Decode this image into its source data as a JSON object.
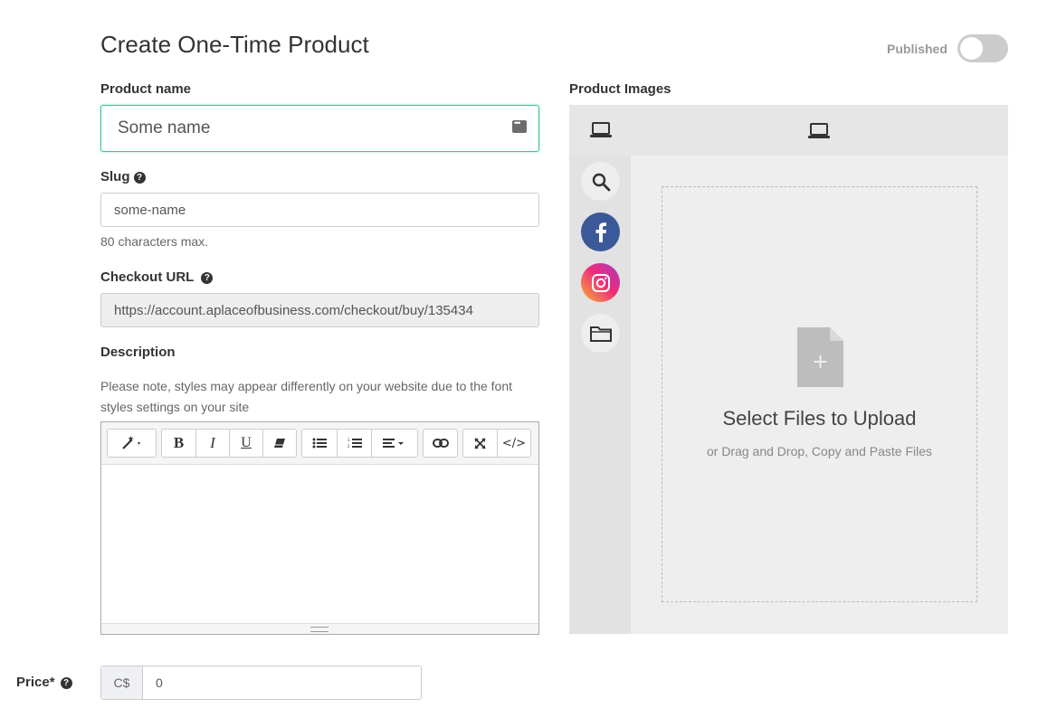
{
  "page": {
    "title": "Create One-Time Product"
  },
  "published": {
    "label": "Published",
    "checked": false
  },
  "product_name": {
    "label": "Product name",
    "value": "Some name"
  },
  "slug": {
    "label": "Slug",
    "value": "some-name",
    "hint": "80 characters max."
  },
  "checkout_url": {
    "label": "Checkout URL",
    "value": "https://account.aplaceofbusiness.com/checkout/buy/135434"
  },
  "description": {
    "label": "Description",
    "note": "Please note, styles may appear differently on your website due to the font styles settings on your site",
    "toolbar": {
      "bold": "B",
      "italic": "I",
      "underline": "U",
      "code": "</>"
    }
  },
  "images": {
    "label": "Product Images",
    "upload_title": "Select Files to Upload",
    "upload_subtitle": "or Drag and Drop, Copy and Paste Files"
  },
  "price": {
    "label": "Price*",
    "currency": "C$",
    "value": "0"
  },
  "colors": {
    "accent": "#35c59b",
    "facebook": "#3b5998",
    "instagram": "#e1306c"
  }
}
